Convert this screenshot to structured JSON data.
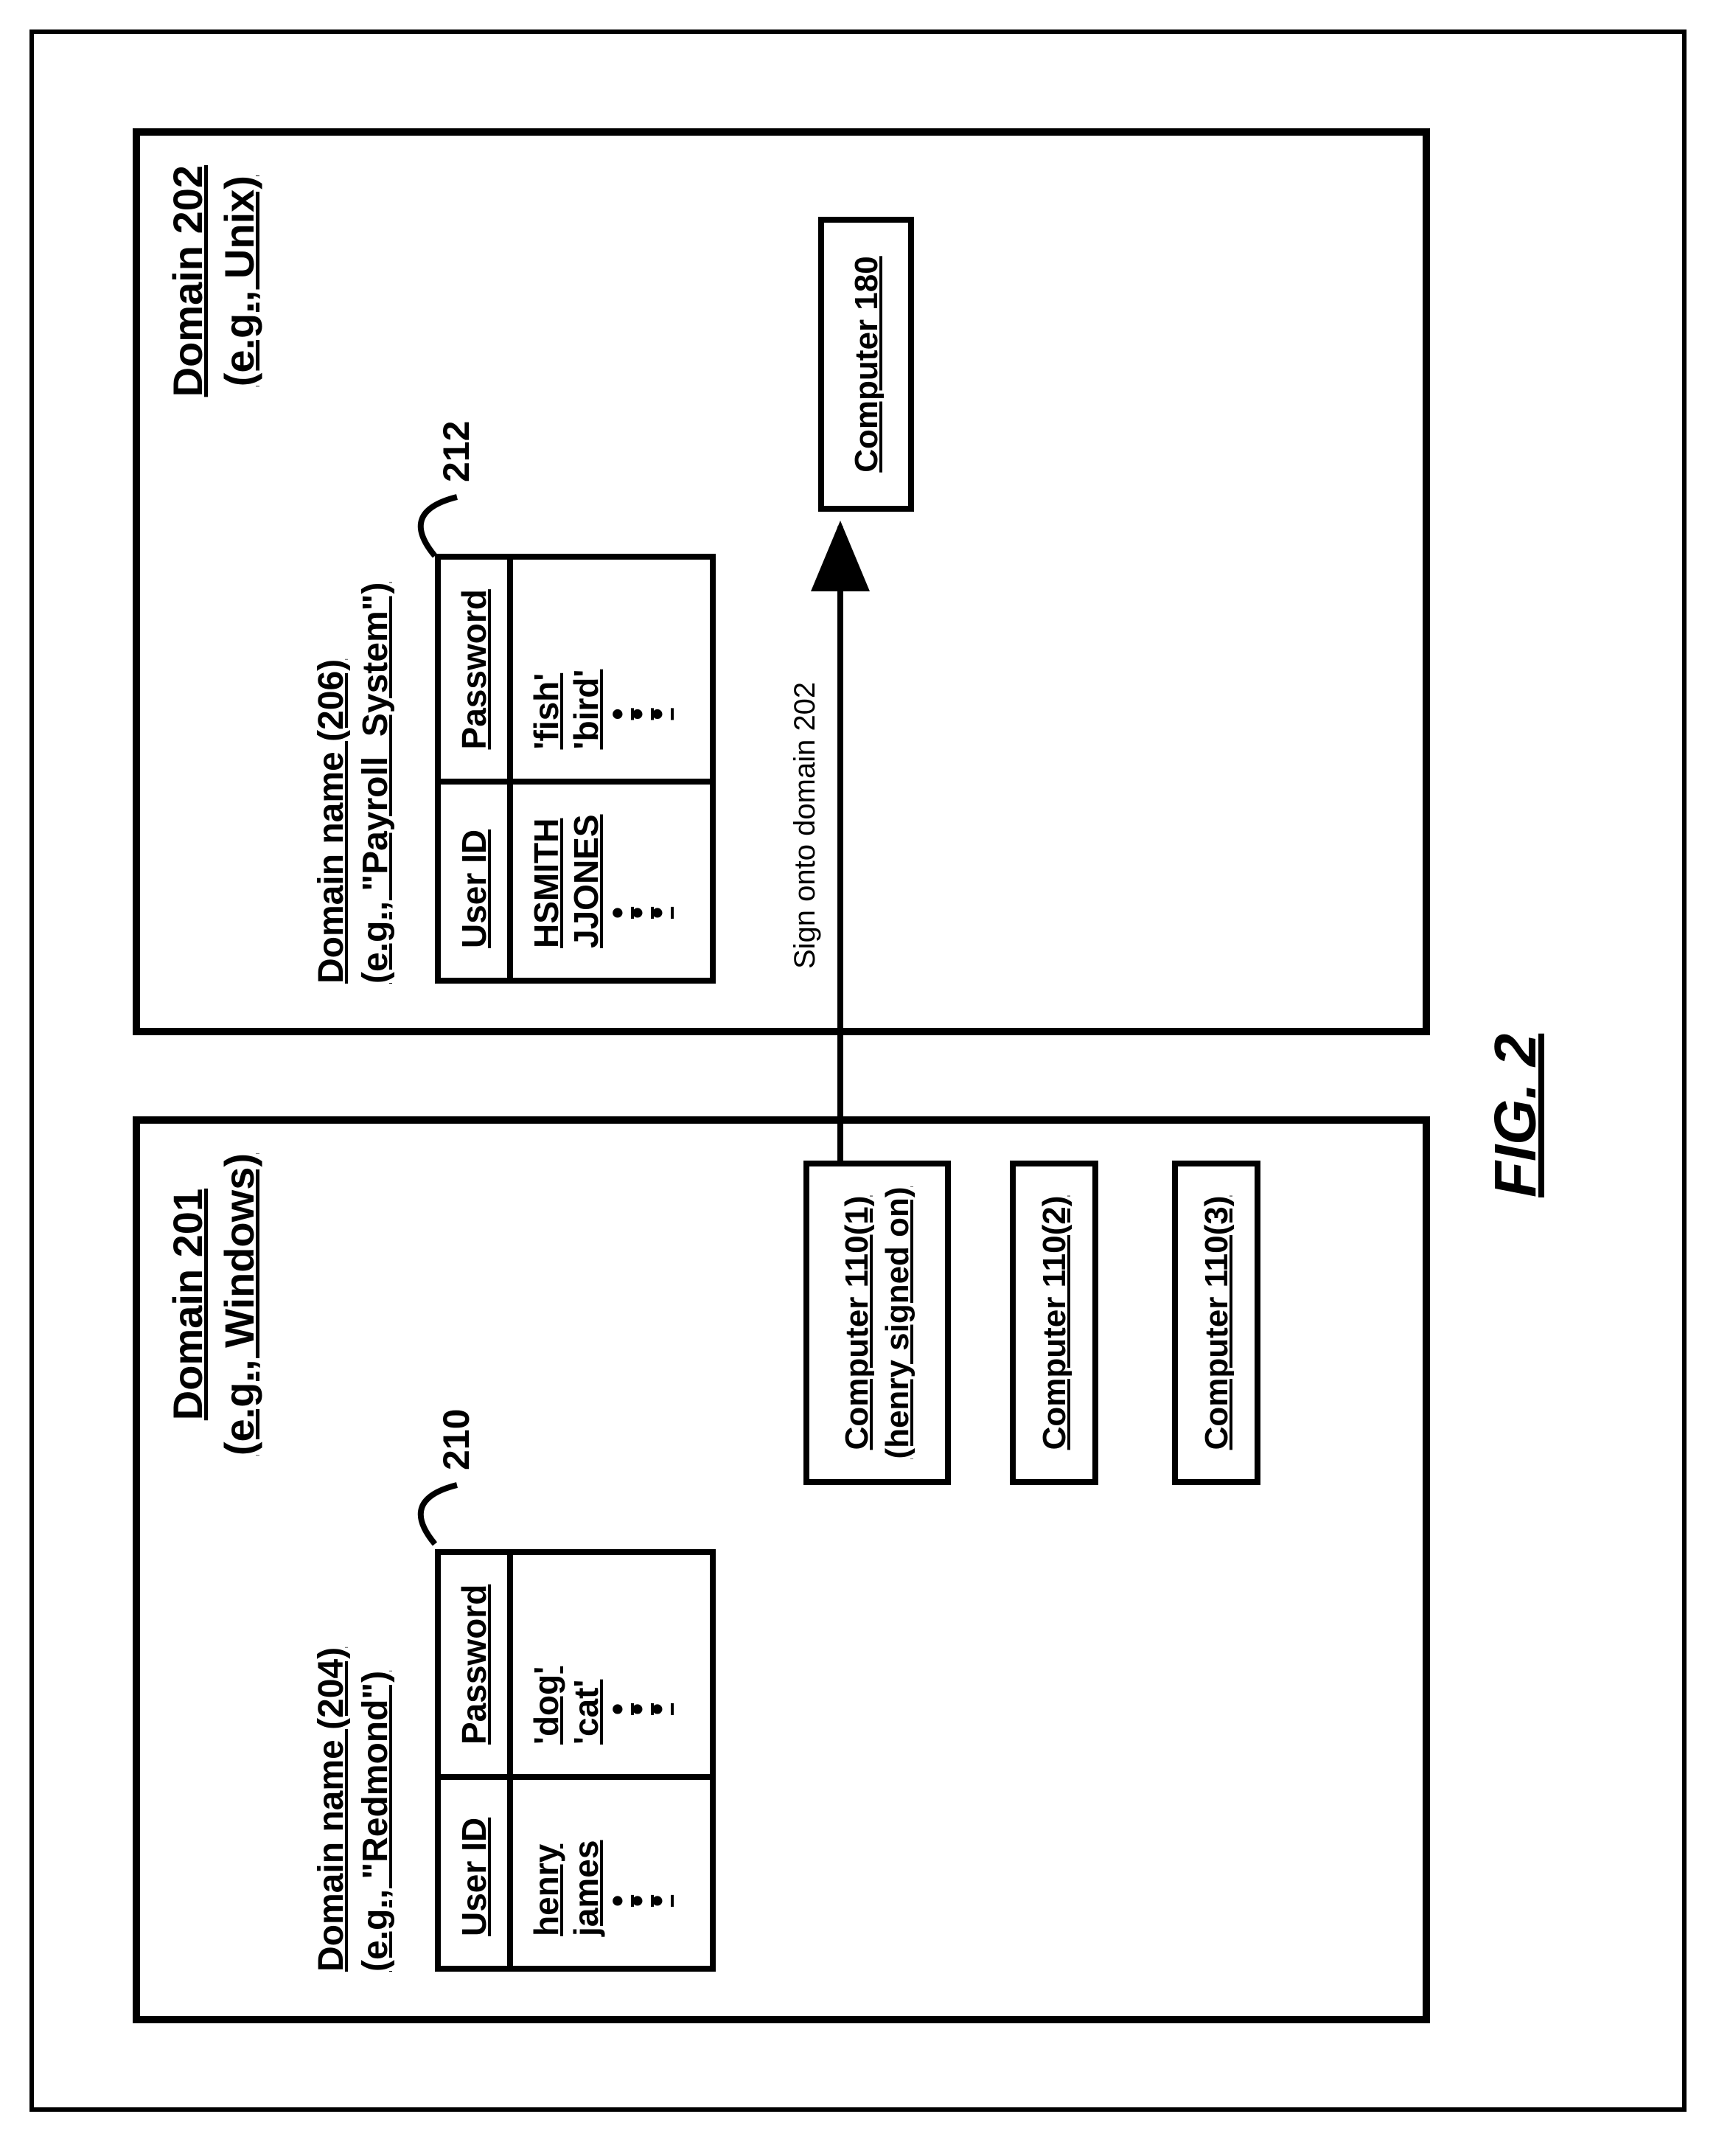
{
  "figure_caption": "FIG. 2",
  "domain201": {
    "title_line1": "Domain 201",
    "title_line2": "(e.g., Windows)",
    "name_line1": "Domain name (204)",
    "name_line2": "(e.g., \"Redmond\")",
    "table_ref": "210",
    "headers": {
      "col1": "User ID",
      "col2": "Password"
    },
    "rows": [
      {
        "user": "henry",
        "pwd": "'dog'"
      },
      {
        "user": "james",
        "pwd": "'cat'"
      }
    ],
    "computers": {
      "c1_line1": "Computer 110(1)",
      "c1_line2": "(henry signed on)",
      "c2": "Computer 110(2)",
      "c3": "Computer 110(3)"
    }
  },
  "domain202": {
    "title_line1": "Domain 202",
    "title_line2": "(e.g., Unix)",
    "name_line1": "Domain name (206)",
    "name_line2": "(e.g., \"Payroll_System\")",
    "table_ref": "212",
    "headers": {
      "col1": "User ID",
      "col2": "Password"
    },
    "rows": [
      {
        "user": "HSMITH",
        "pwd": "'fish'"
      },
      {
        "user": "JJONES",
        "pwd": "'bird'"
      }
    ],
    "computer": "Computer 180"
  },
  "arrow_label": "Sign onto domain 202"
}
